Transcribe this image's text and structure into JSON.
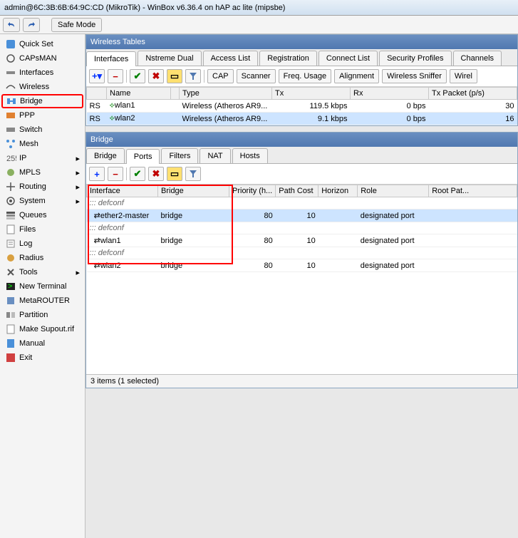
{
  "title": "admin@6C:3B:6B:64:9C:CD (MikroTik) - WinBox v6.36.4 on hAP ac lite (mipsbe)",
  "safe_mode": "Safe Mode",
  "sidebar": {
    "items": [
      {
        "label": "Quick Set"
      },
      {
        "label": "CAPsMAN"
      },
      {
        "label": "Interfaces"
      },
      {
        "label": "Wireless"
      },
      {
        "label": "Bridge"
      },
      {
        "label": "PPP"
      },
      {
        "label": "Switch"
      },
      {
        "label": "Mesh"
      },
      {
        "label": "IP"
      },
      {
        "label": "MPLS"
      },
      {
        "label": "Routing"
      },
      {
        "label": "System"
      },
      {
        "label": "Queues"
      },
      {
        "label": "Files"
      },
      {
        "label": "Log"
      },
      {
        "label": "Radius"
      },
      {
        "label": "Tools"
      },
      {
        "label": "New Terminal"
      },
      {
        "label": "MetaROUTER"
      },
      {
        "label": "Partition"
      },
      {
        "label": "Make Supout.rif"
      },
      {
        "label": "Manual"
      },
      {
        "label": "Exit"
      }
    ]
  },
  "wireless": {
    "title": "Wireless Tables",
    "tabs": [
      "Interfaces",
      "Nstreme Dual",
      "Access List",
      "Registration",
      "Connect List",
      "Security Profiles",
      "Channels"
    ],
    "buttons": [
      "CAP",
      "Scanner",
      "Freq. Usage",
      "Alignment",
      "Wireless Sniffer",
      "Wirel"
    ],
    "cols": [
      "",
      "Name",
      "",
      "Type",
      "Tx",
      "Rx",
      "Tx Packet (p/s)"
    ],
    "rows": [
      {
        "flag": "RS",
        "name": "wlan1",
        "type": "Wireless (Atheros AR9...",
        "tx": "119.5 kbps",
        "rx": "0 bps",
        "txp": "30"
      },
      {
        "flag": "RS",
        "name": "wlan2",
        "type": "Wireless (Atheros AR9...",
        "tx": "9.1 kbps",
        "rx": "0 bps",
        "txp": "16"
      }
    ]
  },
  "bridge": {
    "title": "Bridge",
    "tabs": [
      "Bridge",
      "Ports",
      "Filters",
      "NAT",
      "Hosts"
    ],
    "cols": [
      "Interface",
      "Bridge",
      "Priority (h...",
      "Path Cost",
      "Horizon",
      "Role",
      "Root Pat..."
    ],
    "rows": [
      {
        "group": "::: defconf"
      },
      {
        "iface": "ether2-master",
        "bridge": "bridge",
        "prio": "80",
        "path": "10",
        "role": "designated port",
        "sel": true
      },
      {
        "group": "::: defconf"
      },
      {
        "iface": "wlan1",
        "bridge": "bridge",
        "prio": "80",
        "path": "10",
        "role": "designated port"
      },
      {
        "group": "::: defconf"
      },
      {
        "iface": "wlan2",
        "bridge": "bridge",
        "prio": "80",
        "path": "10",
        "role": "designated port"
      }
    ],
    "status": "3 items (1 selected)"
  }
}
